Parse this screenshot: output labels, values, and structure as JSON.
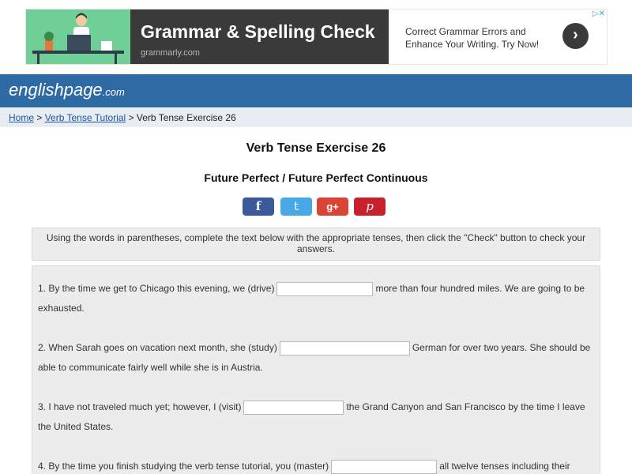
{
  "ad": {
    "headline": "Grammar & Spelling Check",
    "domain": "grammarly.com",
    "description": "Correct Grammar Errors and Enhance Your Writing. Try Now!",
    "arrow_icon": "chevron-right-icon",
    "choices_icon": "adchoices-icon",
    "colors": {
      "image_bg": "#6fcf97",
      "panel_bg": "#3a3a3a"
    }
  },
  "site": {
    "logo_main": "englishpage",
    "logo_tld": ".com",
    "header_color": "#2e6aa3"
  },
  "breadcrumb": {
    "home": "Home",
    "sep1": " > ",
    "tutorial": "Verb Tense Tutorial",
    "sep2": " > ",
    "current": "Verb Tense Exercise 26"
  },
  "page": {
    "title": "Verb Tense Exercise 26",
    "subtitle": "Future Perfect / Future Perfect Continuous"
  },
  "social": {
    "facebook": "f",
    "twitter": "t",
    "googleplus": "g+",
    "pinterest": "p"
  },
  "instructions": "Using the words in parentheses, complete the text below with the appropriate tenses, then click the \"Check\" button to check your answers.",
  "questions": [
    {
      "before": "1. By the time we get to Chicago this evening, we (drive)",
      "value": "",
      "after": "more than four hundred miles. We are going to be exhausted."
    },
    {
      "before": "2. When Sarah goes on vacation next month, she (study)",
      "value": "",
      "after": "German for over two years. She should be able to communicate fairly well while she is in Austria."
    },
    {
      "before": "3. I have not traveled much yet; however, I (visit)",
      "value": "",
      "after": "the Grand Canyon and San Francisco by the time I leave the United States."
    },
    {
      "before": "4. By the time you finish studying the verb tense tutorial, you (master)",
      "value": "",
      "after": "all twelve tenses including their"
    }
  ]
}
